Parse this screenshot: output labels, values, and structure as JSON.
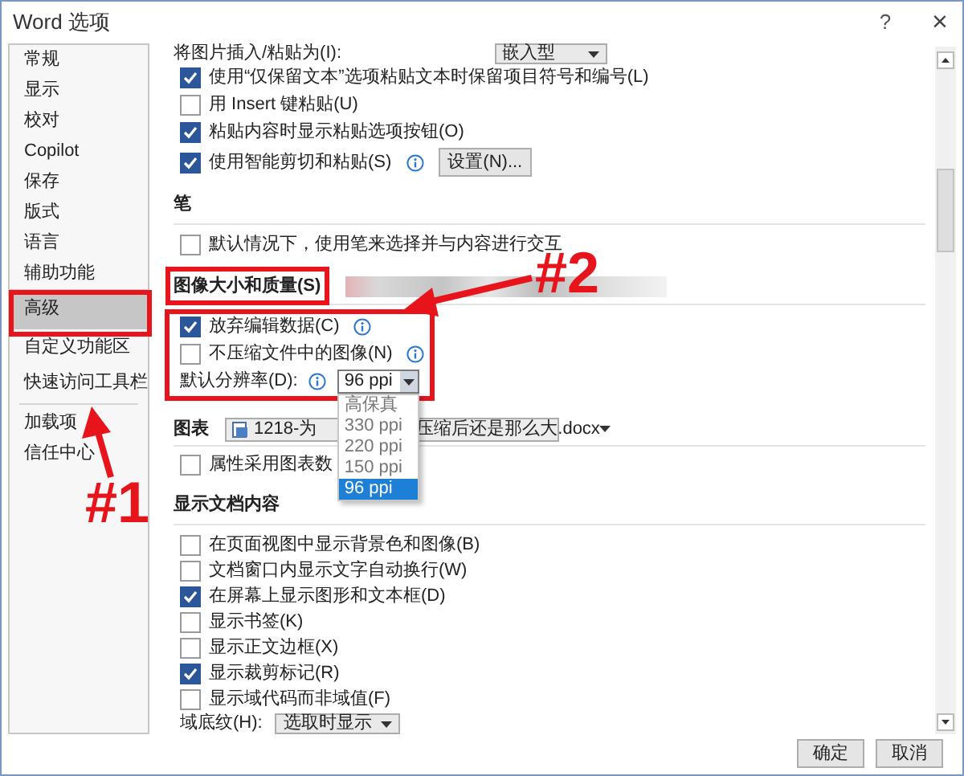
{
  "window": {
    "title": "Word 选项",
    "help": "?",
    "close": "×"
  },
  "sidebar": {
    "groups": [
      [
        {
          "label": "常规",
          "selected": false
        },
        {
          "label": "显示",
          "selected": false
        },
        {
          "label": "校对",
          "selected": false
        },
        {
          "label": "Copilot",
          "selected": false
        },
        {
          "label": "保存",
          "selected": false
        },
        {
          "label": "版式",
          "selected": false
        },
        {
          "label": "语言",
          "selected": false
        },
        {
          "label": "辅助功能",
          "selected": false
        },
        {
          "label": "高级",
          "selected": true
        },
        {
          "label": "自定义功能区",
          "selected": false
        },
        {
          "label": "快速访问工具栏",
          "selected": false
        }
      ],
      [
        {
          "label": "加载项",
          "selected": false
        },
        {
          "label": "信任中心",
          "selected": false
        }
      ]
    ]
  },
  "content": [
    {
      "kind": "field",
      "label": "将图片插入/粘贴为(I):",
      "value": "嵌入型"
    },
    {
      "kind": "checkbox",
      "label": "使用“仅保留文本”选项粘贴文本时保留项目符号和编号(L)",
      "checked": true,
      "info": false
    },
    {
      "kind": "checkbox",
      "label": "用 Insert 键粘贴(U)",
      "checked": false,
      "info": false
    },
    {
      "kind": "checkbox",
      "label": "粘贴内容时显示粘贴选项按钮(O)",
      "checked": true,
      "info": false
    },
    {
      "kind": "checkbox",
      "label": "使用智能剪切和粘贴(S)",
      "checked": true,
      "info": true,
      "button": "设置(N)..."
    },
    {
      "kind": "section",
      "title": "笔"
    },
    {
      "kind": "checkbox",
      "label": "默认情况下，使用笔来选择并与内容进行交互",
      "checked": false,
      "info": false
    },
    {
      "kind": "image_section",
      "title": "图像大小和质量(S)"
    },
    {
      "kind": "checkbox",
      "label": "放弃编辑数据(C)",
      "checked": true,
      "info": true
    },
    {
      "kind": "checkbox",
      "label": "不压缩文件中的图像(N)",
      "checked": false,
      "info": true
    },
    {
      "kind": "resolution",
      "label": "默认分辨率(D):",
      "value": "96 ppi",
      "options": [
        {
          "label": "高保真",
          "selected": false
        },
        {
          "label": "330 ppi",
          "selected": false
        },
        {
          "label": "220 ppi",
          "selected": false
        },
        {
          "label": "150 ppi",
          "selected": false
        },
        {
          "label": "96 ppi",
          "selected": true
        }
      ]
    },
    {
      "kind": "chart",
      "label": "图表",
      "file_parts": [
        "1218-为",
        "压缩后还是那么大.docx"
      ]
    },
    {
      "kind": "checkbox",
      "label": "属性采用图表数",
      "checked": false,
      "info": false
    },
    {
      "kind": "section",
      "title": "显示文档内容"
    },
    {
      "kind": "checkbox",
      "label": "在页面视图中显示背景色和图像(B)",
      "checked": false,
      "info": false
    },
    {
      "kind": "checkbox",
      "label": "文档窗口内显示文字自动换行(W)",
      "checked": false,
      "info": false
    },
    {
      "kind": "checkbox",
      "label": "在屏幕上显示图形和文本框(D)",
      "checked": true,
      "info": false
    },
    {
      "kind": "checkbox",
      "label": "显示书签(K)",
      "checked": false,
      "info": false
    },
    {
      "kind": "checkbox",
      "label": "显示正文边框(X)",
      "checked": false,
      "info": false
    },
    {
      "kind": "checkbox",
      "label": "显示裁剪标记(R)",
      "checked": true,
      "info": false
    },
    {
      "kind": "checkbox",
      "label": "显示域代码而非域值(F)",
      "checked": false,
      "info": false
    },
    {
      "kind": "field",
      "label": "域底纹(H):",
      "value": "选取时显示"
    }
  ],
  "buttons": [
    "确定",
    "取消"
  ],
  "annotations": [
    {
      "text": "#1"
    },
    {
      "text": "#2"
    }
  ]
}
